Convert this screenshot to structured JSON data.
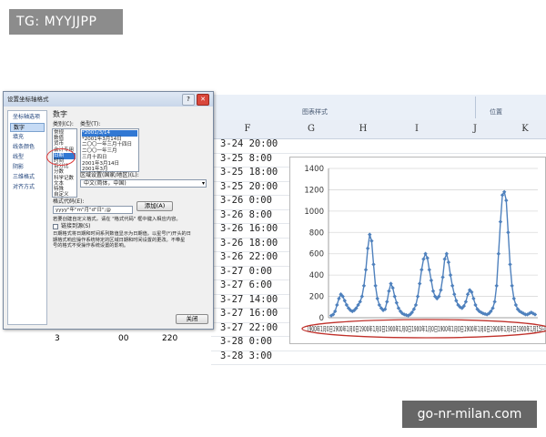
{
  "tag": "TG: MYYJJPP",
  "watermark": "go-nr-milan.com",
  "ribbon": {
    "group_chart_styles": "图表样式",
    "group_position": "位置"
  },
  "sheet": {
    "columns": [
      "F",
      "G",
      "H",
      "I",
      "J",
      "K"
    ],
    "col_e_values": [
      "3-24 20:00",
      "3-25 8:00",
      "3-25 18:00",
      "3-25 20:00",
      "3-26 0:00",
      "3-26 8:00",
      "3-26 16:00",
      "3-26 18:00",
      "3-26 22:00",
      "3-27 0:00",
      "3-27 6:00",
      "3-27 14:00",
      "3-27 16:00",
      "3-27 22:00",
      "3-28 0:00",
      "3-28 3:00"
    ],
    "bottom_row": [
      "3",
      "00",
      "220"
    ]
  },
  "dialog": {
    "title": "设置坐标轴格式",
    "close_label": "关闭",
    "nav_items": [
      "坐标轴选项",
      "数字",
      "填充",
      "线条颜色",
      "线型",
      "阴影",
      "三维格式",
      "对齐方式"
    ],
    "nav_selected": 1,
    "section_title": "数字",
    "category_label": "类别(C):",
    "categories": [
      "常规",
      "数值",
      "货币",
      "会计专用",
      "日期",
      "时间",
      "百分比",
      "分数",
      "科学记数",
      "文本",
      "特殊",
      "自定义"
    ],
    "category_selected": 4,
    "type_label": "类型(T):",
    "types": [
      "*2001/3/14",
      "*2001年3月14日",
      "二〇〇一年三月十四日",
      "二〇〇一年三月",
      "三月十四日",
      "2001年3月14日",
      "2001年3月"
    ],
    "type_selected": 0,
    "locale_label": "区域设置(国家/地区)(L):",
    "locale_value": "中文(简体，中国)",
    "format_code_label": "格式代码(E):",
    "format_code_value": "yyyy\"年\"m\"月\"d\"日\";@",
    "add_label": "添加(A)",
    "hint_line1": "若要创建自定义格式，请在 \"格式代码\" 框中键入相应内容。",
    "link_source_label": "链接到源(S)",
    "desc_lines": [
      "日期格式将日期和时间系列数值显示为日期值。以星号(*)开头的日",
      "期格式响应操作系统特定的区域日期和时间设置的更改。不带星",
      "号的格式不受操作系统设置的影响。"
    ]
  },
  "chart_data": {
    "type": "line",
    "ylim": [
      0,
      1400
    ],
    "yticks": [
      0,
      200,
      400,
      600,
      800,
      1000,
      1200,
      1400
    ],
    "xaxis_label_text": "1900年1月0日1900年1月0日1900年1月0日1900年1月0日1900年1月0日1900年1月0日1900年1月0日1900年1月0日1900年1月15日",
    "values": [
      20,
      30,
      60,
      120,
      180,
      220,
      200,
      160,
      120,
      90,
      70,
      60,
      70,
      90,
      120,
      150,
      200,
      300,
      450,
      650,
      780,
      720,
      500,
      300,
      180,
      120,
      90,
      70,
      80,
      150,
      250,
      320,
      280,
      200,
      140,
      90,
      60,
      40,
      30,
      25,
      20,
      30,
      50,
      80,
      120,
      200,
      320,
      450,
      550,
      600,
      560,
      450,
      350,
      250,
      200,
      180,
      200,
      260,
      380,
      550,
      600,
      520,
      400,
      300,
      220,
      160,
      120,
      100,
      90,
      110,
      150,
      220,
      260,
      240,
      180,
      120,
      80,
      60,
      50,
      40,
      35,
      30,
      40,
      60,
      90,
      150,
      300,
      600,
      900,
      1150,
      1180,
      1100,
      800,
      500,
      300,
      180,
      120,
      80,
      60,
      50,
      40,
      30,
      30,
      40,
      50,
      40,
      30
    ]
  }
}
